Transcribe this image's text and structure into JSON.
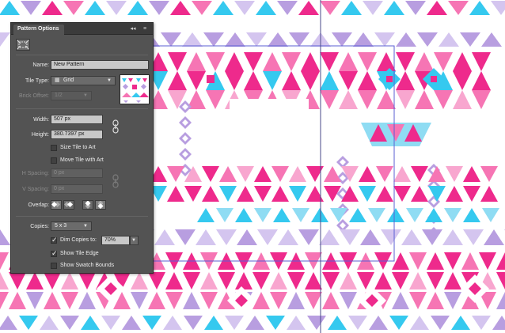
{
  "panel": {
    "title": "Pattern Options",
    "collapse_icon": "double-chevron-left-icon",
    "menu_icon": "panel-menu-icon",
    "tile_tool_icon": "pattern-tile-tool-icon",
    "name_label": "Name:",
    "name_value": "New Pattern",
    "tile_type_label": "Tile Type:",
    "tile_type_value": "Grid",
    "brick_offset_label": "Brick Offset:",
    "brick_offset_value": "1/2",
    "width_label": "Width:",
    "width_value": "507 px",
    "height_label": "Height:",
    "height_value": "380.7397 px",
    "size_tile_to_art_label": "Size Tile to Art",
    "size_tile_to_art_checked": false,
    "move_tile_with_art_label": "Move Tile with Art",
    "move_tile_with_art_checked": false,
    "h_spacing_label": "H Spacing:",
    "h_spacing_value": "0 px",
    "v_spacing_label": "V Spacing:",
    "v_spacing_value": "0 px",
    "overlap_label": "Overlap:",
    "copies_label": "Copies:",
    "copies_value": "5 x 3",
    "dim_copies_label": "Dim Copies to:",
    "dim_copies_checked": true,
    "dim_copies_value": "70%",
    "show_tile_edge_label": "Show Tile Edge",
    "show_tile_edge_checked": true,
    "show_swatch_bounds_label": "Show Swatch Bounds",
    "show_swatch_bounds_checked": false
  },
  "colors": {
    "magenta": "#ee2a8c",
    "pink": "#f675b4",
    "light_pink": "#f8a6cf",
    "cyan": "#35c9ef",
    "light_cyan": "#8fdcf3",
    "lavender": "#b89ee0",
    "light_lavender": "#d4c5ef",
    "panel_bg": "#535353",
    "tile_edge": "#5b5fd3"
  }
}
